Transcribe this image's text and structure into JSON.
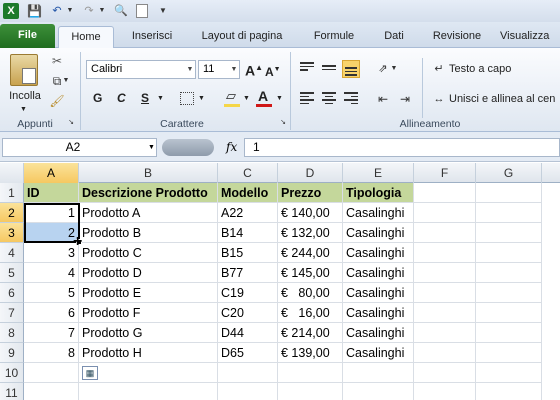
{
  "app": {
    "icon": "X"
  },
  "tabs": [
    "File",
    "Home",
    "Inserisci",
    "Layout di pagina",
    "Formule",
    "Dati",
    "Revisione",
    "Visualizza"
  ],
  "ribbon": {
    "paste_label": "Incolla",
    "clipboard_group": "Appunti",
    "font_name": "Calibri",
    "font_size": "11",
    "grow_font": "A",
    "shrink_font": "A",
    "bold": "G",
    "italic": "C",
    "underline": "S",
    "font_group": "Carattere",
    "wrap_text": "Testo a capo",
    "merge_center": "Unisci e allinea al cen",
    "alignment_group": "Allineamento",
    "fx": "fx"
  },
  "formula_bar": {
    "name_box": "A2",
    "formula": "1"
  },
  "columns": [
    "A",
    "B",
    "C",
    "D",
    "E",
    "F",
    "G"
  ],
  "rows": [
    "1",
    "2",
    "3",
    "4",
    "5",
    "6",
    "7",
    "8",
    "9",
    "10",
    "11"
  ],
  "table": {
    "headers": [
      "ID",
      "Descrizione Prodotto",
      "Modello",
      "Prezzo",
      "Tipologia"
    ],
    "rows": [
      [
        "1",
        "Prodotto A",
        "A22",
        "€ 140,00",
        "Casalinghi"
      ],
      [
        "2",
        "Prodotto B",
        "B14",
        "€ 132,00",
        "Casalinghi"
      ],
      [
        "3",
        "Prodotto C",
        "B15",
        "€ 244,00",
        "Casalinghi"
      ],
      [
        "4",
        "Prodotto D",
        "B77",
        "€ 145,00",
        "Casalinghi"
      ],
      [
        "5",
        "Prodotto E",
        "C19",
        "€   80,00",
        "Casalinghi"
      ],
      [
        "6",
        "Prodotto F",
        "C20",
        "€   16,00",
        "Casalinghi"
      ],
      [
        "7",
        "Prodotto G",
        "D44",
        "€ 214,00",
        "Casalinghi"
      ],
      [
        "8",
        "Prodotto H",
        "D65",
        "€ 139,00",
        "Casalinghi"
      ]
    ]
  },
  "colors": {
    "header_fill": "#c4d79b",
    "file_tab": "#2a7d2a",
    "selection": "#b8d3f0",
    "font_color": "#d01818",
    "highlight": "#f5d648"
  }
}
